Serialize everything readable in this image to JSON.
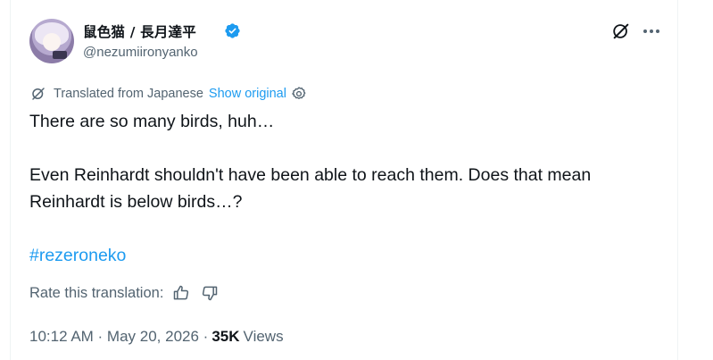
{
  "author": {
    "display_name": "鼠色猫 / 長月達平",
    "handle": "@nezumiironyanko",
    "verified": true
  },
  "icons": {
    "grok": "grok-icon",
    "more": "more-icon",
    "translate": "translate-icon",
    "settings": "gear-icon",
    "verified": "verified-badge-icon",
    "thumbs_up": "thumbs-up-icon",
    "thumbs_down": "thumbs-down-icon"
  },
  "translation": {
    "label": "Translated from Japanese",
    "show_original": "Show original"
  },
  "post": {
    "line1": "There are so many birds, huh…",
    "line2": "Even Reinhardt shouldn't have been able to reach them. Does that mean",
    "line3": "Reinhardt is below birds…?",
    "hashtag": "#rezeroneko"
  },
  "rate": {
    "label": "Rate this translation:"
  },
  "meta": {
    "timestamp": "10:12 AM · May 20, 2026 ·",
    "views_count": "35K",
    "views_label": "Views"
  },
  "colors": {
    "accent": "#1d9bf0",
    "secondary_text": "#536471",
    "primary_text": "#0f1419"
  }
}
